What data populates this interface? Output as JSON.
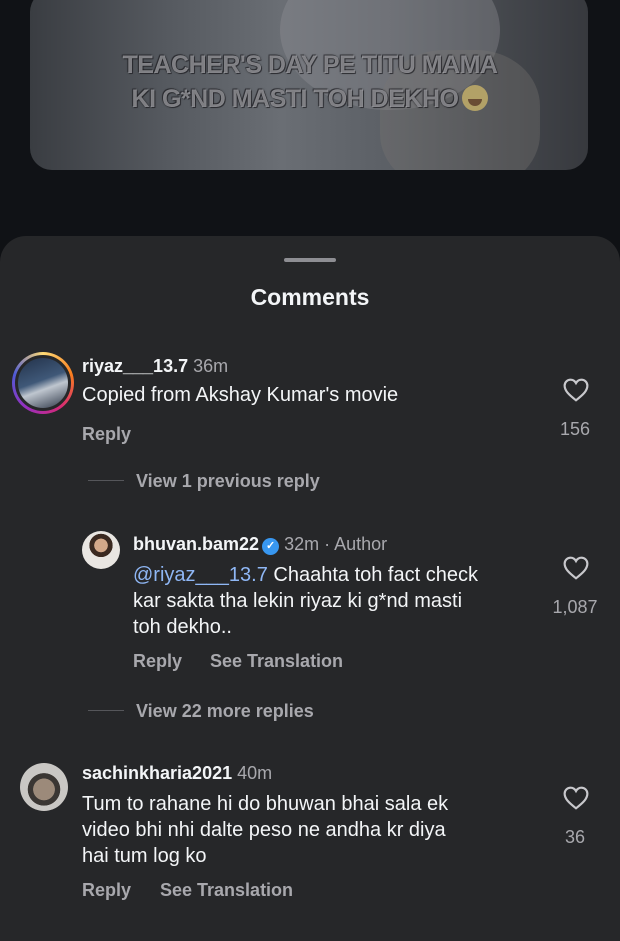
{
  "video": {
    "caption_line1": "TEACHER'S DAY PE TITU MAMA",
    "caption_line2": "KI G*ND MASTI TOH DEKHO",
    "caption_emoji": "laughing-tears-emoji"
  },
  "sheet": {
    "title": "Comments"
  },
  "comments": [
    {
      "username": "riyaz___13.7",
      "time": "36m",
      "text": "Copied from Akshay Kumar's movie",
      "reply_label": "Reply",
      "likes": "156",
      "view_replies": "View 1 previous reply",
      "avatar_icon": "story-ring-avatar"
    },
    {
      "username": "bhuvan.bam22",
      "verified": true,
      "time": "32m",
      "author_tag": "· Author",
      "mention": "@riyaz___13.7",
      "text_line1": "Chaahta toh fact check",
      "text_line2": "kar sakta tha lekin riyaz ki g*nd masti",
      "text_line3": "toh dekho..",
      "reply_label": "Reply",
      "translate_label": "See Translation",
      "likes": "1,087",
      "view_replies": "View 22 more replies"
    },
    {
      "username": "sachinkharia2021",
      "time": "40m",
      "text_line1": "Tum to rahane hi do bhuwan bhai sala ek",
      "text_line2": "video bhi nhi dalte peso ne andha kr diya",
      "text_line3": "hai tum log ko",
      "reply_label": "Reply",
      "translate_label": "See Translation",
      "likes": "36"
    }
  ],
  "colors": {
    "sheet_bg": "#262729",
    "text_primary": "#f3f5f7",
    "text_secondary": "#a8a8ad",
    "mention": "#8fb7f5",
    "verified": "#3897f0"
  },
  "icons": {
    "like": "heart-outline-icon",
    "verified": "verified-badge-icon"
  }
}
